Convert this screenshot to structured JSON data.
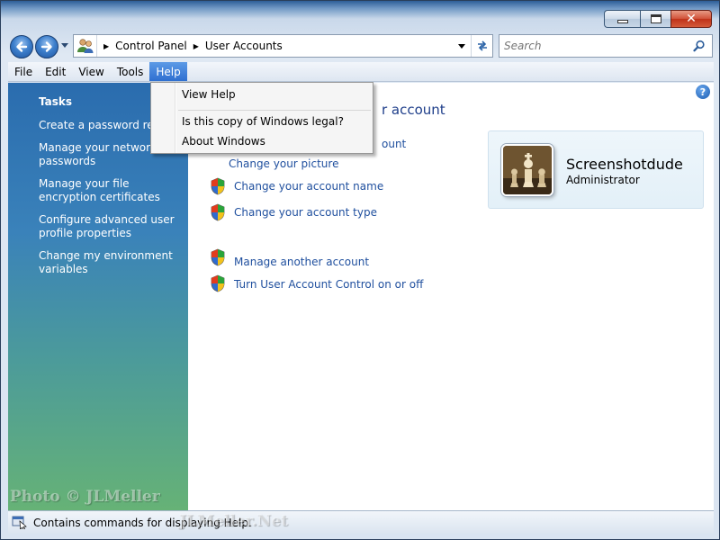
{
  "window": {
    "address_crumbs": [
      "Control Panel",
      "User Accounts"
    ],
    "search_placeholder": "Search",
    "close_glyph": "✕"
  },
  "menubar": {
    "items": [
      "File",
      "Edit",
      "View",
      "Tools",
      "Help"
    ],
    "active": "Help"
  },
  "help_menu": {
    "items": [
      "View Help",
      "Is this copy of Windows legal?",
      "About Windows"
    ]
  },
  "tasks": {
    "title": "Tasks",
    "links": [
      "Create a password reset",
      "Manage your network passwords",
      "Manage your file encryption certificates",
      "Configure advanced user profile properties",
      "Change my environment variables"
    ]
  },
  "main": {
    "title_fragment": "r account",
    "link_fragment": "ount",
    "links": [
      "Change your picture",
      "Change your account name",
      "Change your account type",
      "Manage another account",
      "Turn User Account Control on or off"
    ],
    "help_glyph": "?"
  },
  "user": {
    "name": "Screenshotdude",
    "role": "Administrator"
  },
  "status": {
    "text": "Contains commands for displaying Help."
  },
  "watermark": {
    "line1": "Photo © JLMeller",
    "line2": "JLMeller.Net"
  },
  "colors": {
    "link": "#1f4f9e",
    "menu_active": "#2e6fd0",
    "close_button": "#c4381d"
  },
  "icons": {
    "back": "back-arrow-icon",
    "forward": "forward-arrow-icon",
    "users": "user-accounts-icon",
    "refresh": "refresh-icon",
    "search": "search-icon",
    "shield": "uac-shield-icon",
    "help": "help-icon",
    "status": "help-status-icon"
  }
}
